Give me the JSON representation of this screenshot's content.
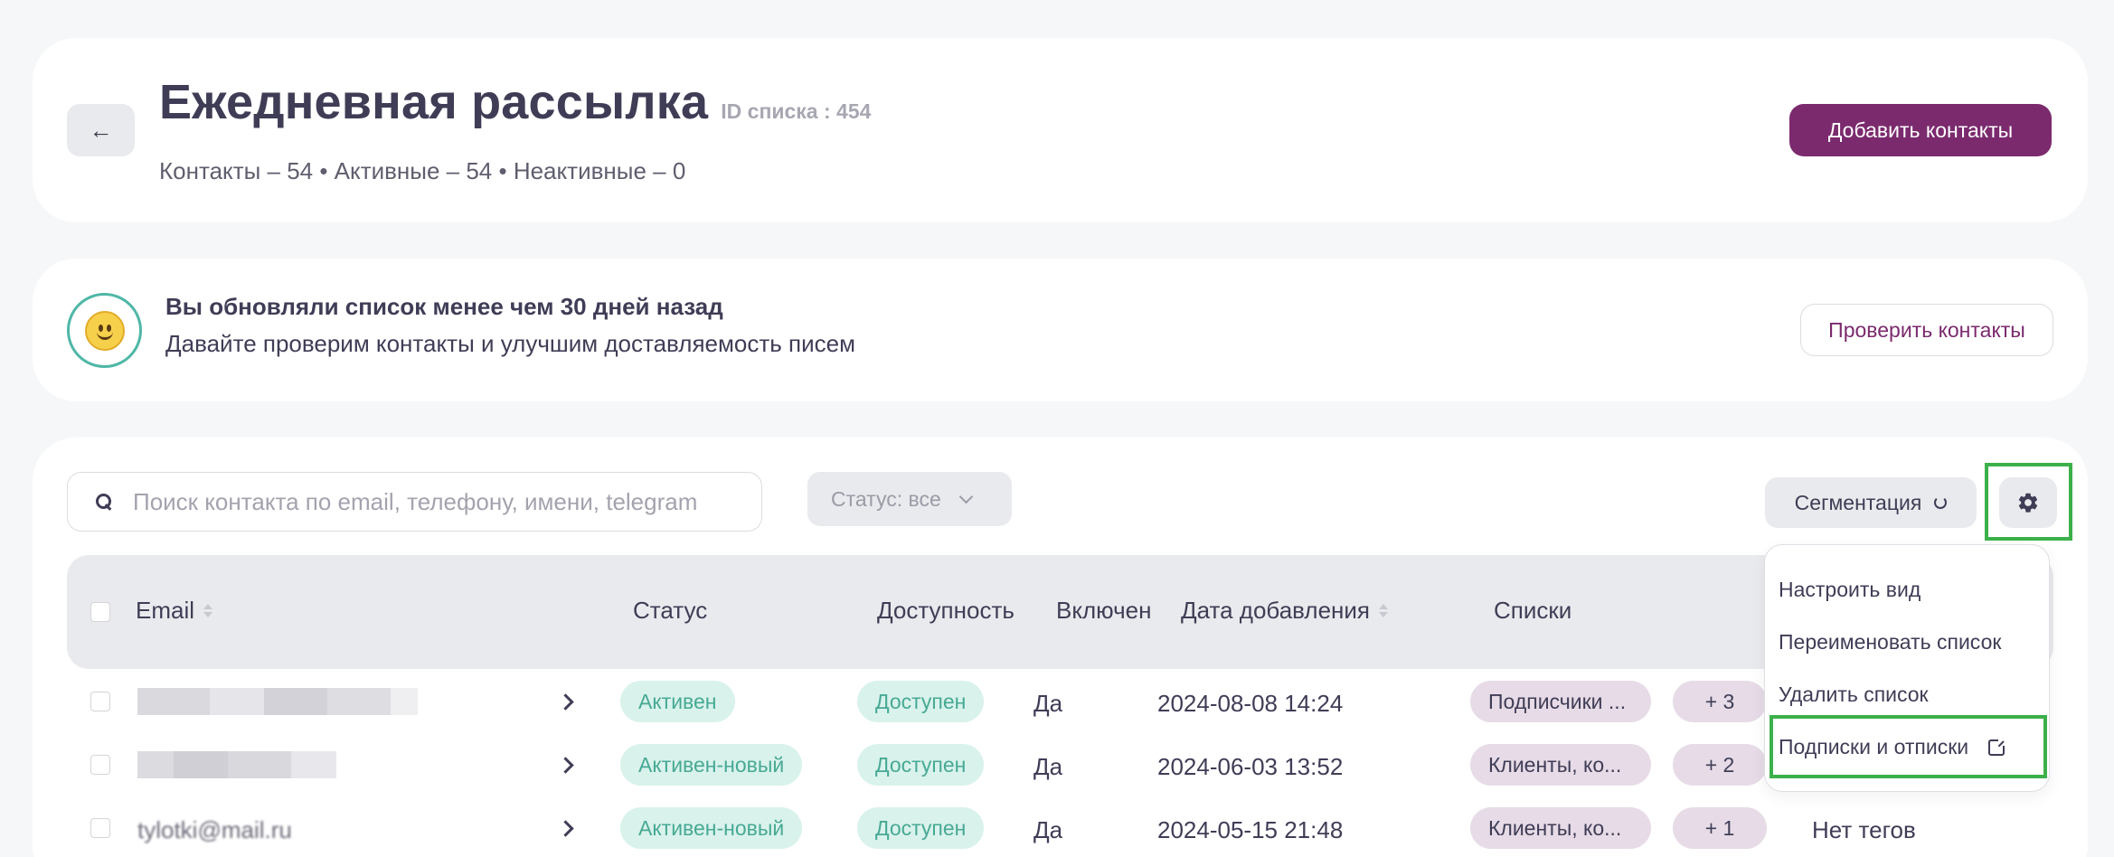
{
  "header": {
    "back_icon": "arrow-left-icon",
    "back_glyph": "←",
    "title": "Ежедневная рассылка",
    "list_id": "ID списка : 454",
    "stats": "Контакты – 54 • Активные – 54 • Неактивные – 0",
    "add_contacts_label": "Добавить контакты"
  },
  "notice": {
    "icon": "smiley-icon",
    "title": "Вы обновляли список менее чем 30 дней назад",
    "subtitle": "Давайте проверим контакты и улучшим доставляемость писем",
    "check_label": "Проверить контакты"
  },
  "toolbar": {
    "search_placeholder": "Поиск контакта по email, телефону, имени, telegram",
    "search_value": "",
    "status_filter": "Статус: все",
    "segmentation_label": "Сегментация",
    "settings_icon": "gear-icon"
  },
  "table": {
    "columns": [
      "Email",
      "Статус",
      "Доступность",
      "Включен",
      "Дата добавления",
      "Списки"
    ],
    "rows": [
      {
        "email": "",
        "status": "Активен",
        "availability": "Доступен",
        "enabled": "Да",
        "date": "2024-08-08 14:24",
        "list": "Подписчики ...",
        "more": "+ 3",
        "tags": ""
      },
      {
        "email": "",
        "status": "Активен-новый",
        "availability": "Доступен",
        "enabled": "Да",
        "date": "2024-06-03 13:52",
        "list": "Клиенты, ко...",
        "more": "+ 2",
        "tags": ""
      },
      {
        "email": "tylotki@mail.ru",
        "status": "Активен-новый",
        "availability": "Доступен",
        "enabled": "Да",
        "date": "2024-05-15 21:48",
        "list": "Клиенты, ко...",
        "more": "+ 1",
        "tags": "Нет тегов"
      }
    ]
  },
  "menu": {
    "items": [
      "Настроить вид",
      "Переименовать список",
      "Удалить список",
      "Подписки и отписки"
    ],
    "external_icon": "external-link-icon"
  },
  "colors": {
    "brand": "#7b2a6e",
    "highlight": "#3cb04a",
    "status_green": "#47a994",
    "list_pill": "#e6dbe6"
  }
}
